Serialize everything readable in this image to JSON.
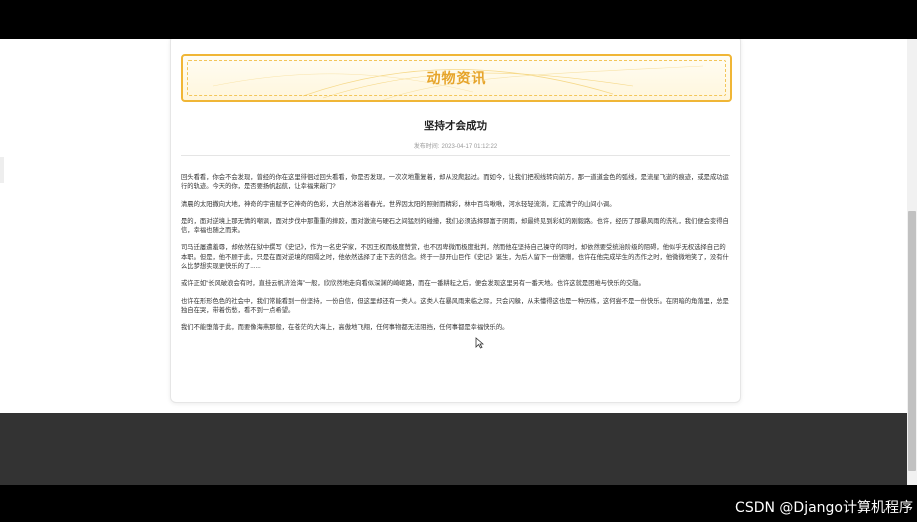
{
  "banner": {
    "title": "动物资讯"
  },
  "article": {
    "title": "坚持才会成功",
    "meta_label": "发布时间:",
    "meta_value": "2023-04-17 01:12:22",
    "paragraphs": [
      "回头看看，你会不会发现，曾经的你在这里徘徊过回头看看，你是否发现，一次次地重复着，却从没爬起过。而如今，让我们把视线转向前方，那一道道金色的弧线，是流星飞逝的痕迹，或是成功运行的轨迹。今天的你，是否要扬帆起航，让幸福来敲门?",
      "清晨的太阳撒向大地，神奇的宇宙赋予它神奇的色彩，大自然沐浴着春光，世界因太阳的照射而精彩，林中百鸟啾啾，河水轻轻流淌，汇成清宁的山间小调。",
      "是的，面对逆境上那无情的嘲讽，面对步伐中那重重的摔跤，面对激流与硬石之间猛烈的碰撞，我们必须选择那富于阴雨，却最终见到彩虹的刚毅路。也许，经历了那暴风雨的洗礼，我们便会变得自信，幸福也随之而来。",
      "司马迁屡遭羞辱，却依然在狱中撰写《史记》，作为一名史学家，不因王权而极度赞赏，也不因卑微而极度批判，然而他在坚持自己操守的同时，却依然要受统治阶级的阻碍，他似乎无权选择自己的本职。但是，他不顾于此，只是在面对逆境的阻隔之时，他依然选择了走下去的信念。终于一部开山巨作《史记》诞生，为后人留下一份馈赠，也许在他完成毕生的杰作之时，他微微地笑了，没有什么比梦想实现更快乐的了......",
      "或许正如“长风破浪会有时，直挂云帆济沧海”一般，欣欣然地走向看似深渊的崎岖路，而在一番耕耘之后，便会发现这里另有一番天地。也许这就是困难与快乐的交融。",
      "也许在形形色色的社会中，我们常能看到一份坚持，一份自信，但这里却还有一类人。这类人在暴风雨来临之际，只会闪躲，从未懂得这也是一种历练，这何尝不是一份快乐。在阴暗的角落里，总是独自在哭，带着伤愁，看不到一点希望。",
      "我们不能堕落于此，而要像海燕那般，在苍茫的大海上，高傲地飞翔，任何事物都无法阻挡，任何事都是幸福快乐的。"
    ]
  },
  "watermark": "CSDN @Django计算机程序",
  "colors": {
    "accent": "#e6a42a",
    "banner_border": "#f0b636",
    "footer": "#333333"
  }
}
